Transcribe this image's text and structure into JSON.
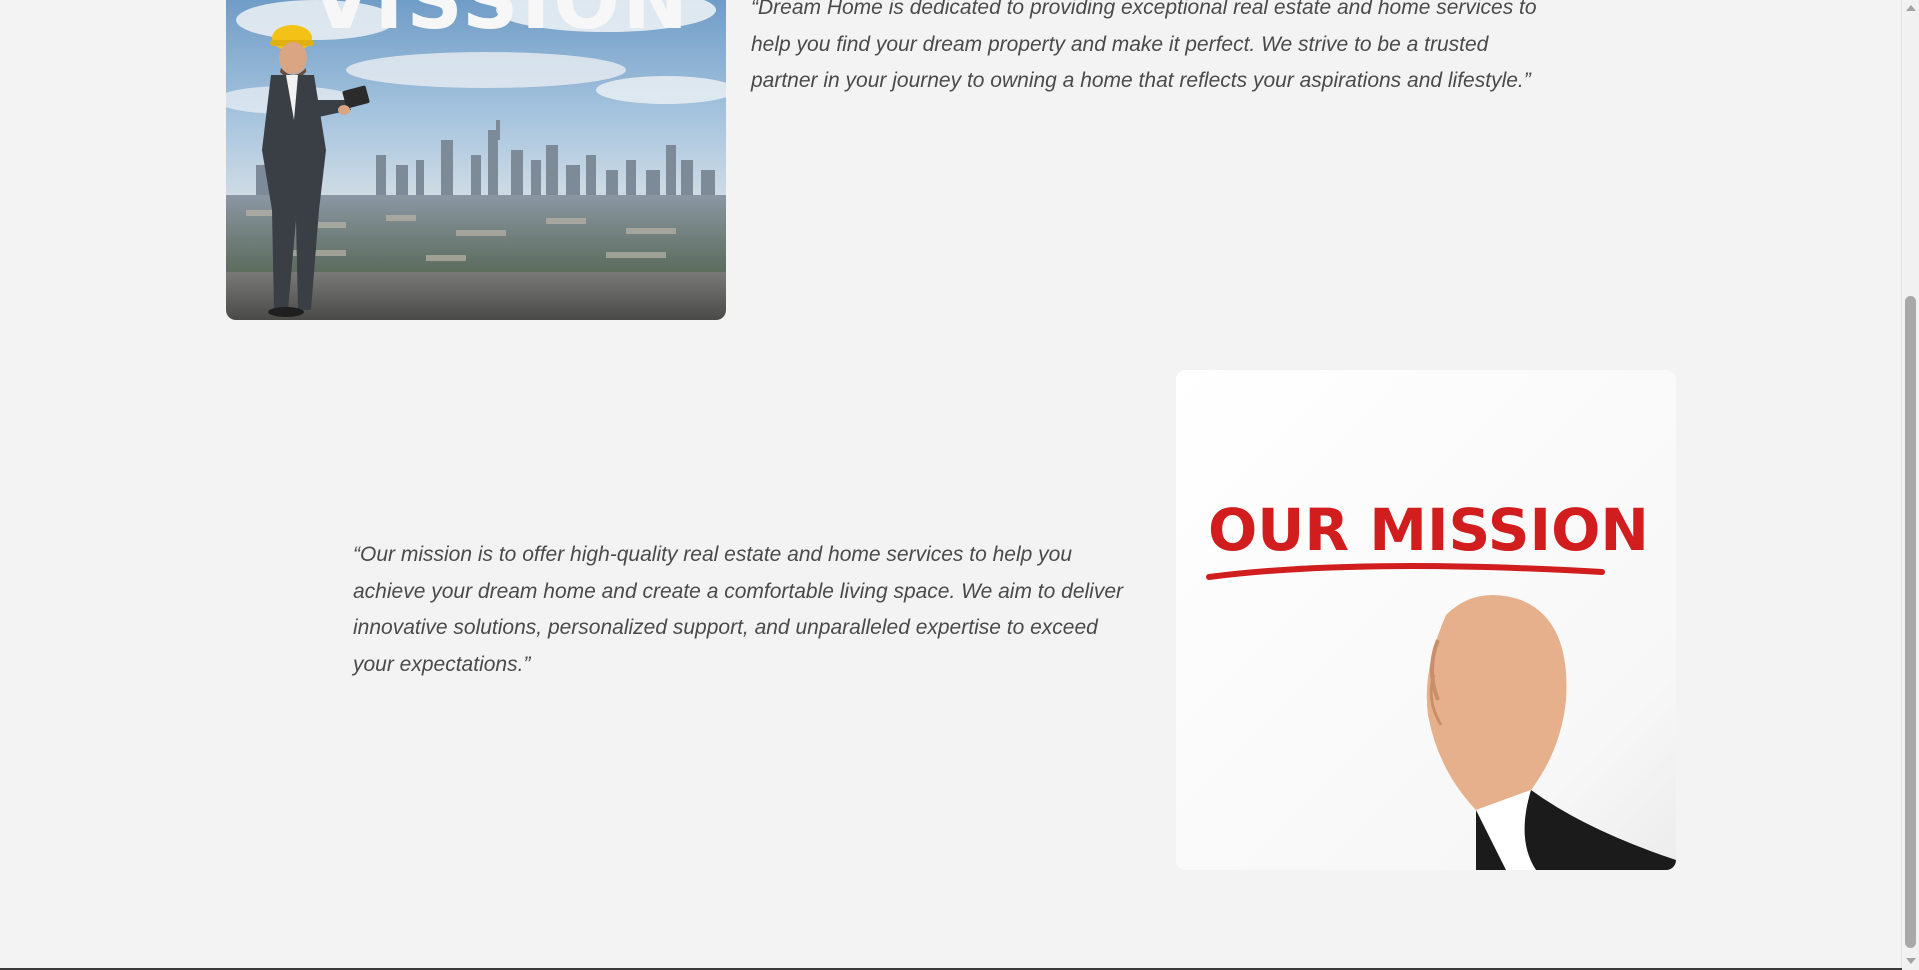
{
  "vision": {
    "image_title": "VISSION",
    "quote": "“Dream Home is dedicated to providing exceptional real estate and home services to help you find your dream property and make it perfect. We strive to be a trusted partner in your journey to owning a home that reflects your aspirations and lifestyle.”"
  },
  "mission": {
    "image_title": "OUR MISSION",
    "quote": "“Our mission is to offer high-quality real estate and home services to help you achieve your dream home and create a comfortable living space. We aim to deliver innovative solutions, personalized support, and unparalleled expertise to exceed your expectations.”"
  },
  "colors": {
    "background": "#f3f3f3",
    "text": "#4a4a4a",
    "mission_red": "#d11d1d"
  }
}
